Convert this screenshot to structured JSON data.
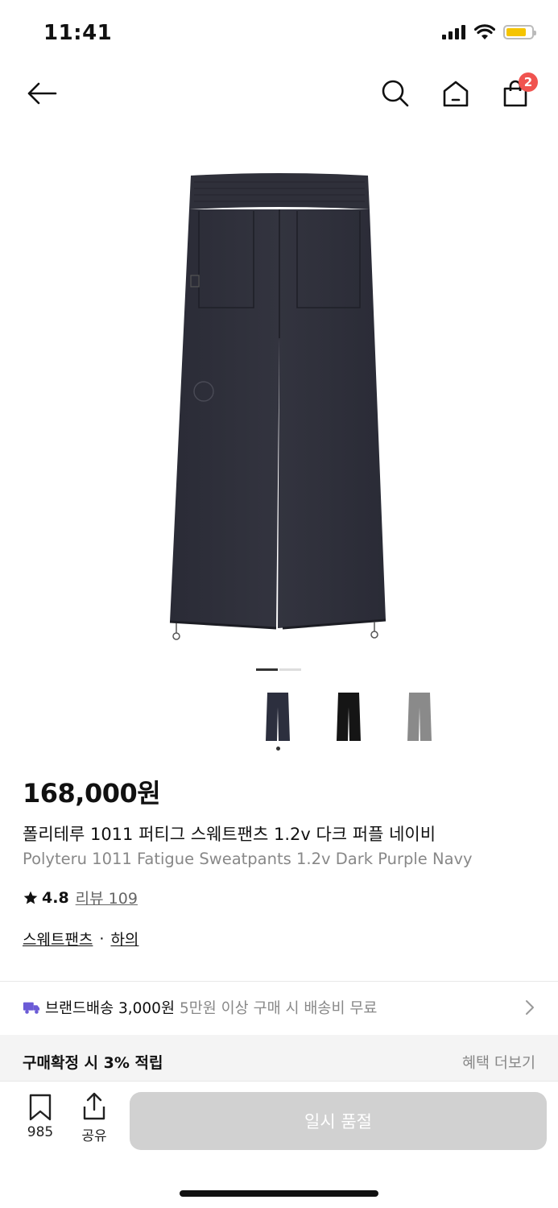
{
  "status_bar": {
    "time": "11:41"
  },
  "header": {
    "cart_count": "2"
  },
  "product": {
    "price": "168,000원",
    "name_ko": "폴리테루 1011 퍼티그 스웨트팬츠 1.2v 다크 퍼플 네이비",
    "name_en": "Polyteru 1011 Fatigue Sweatpants 1.2v Dark Purple Navy",
    "rating": "4.8",
    "review_label": "리뷰 109",
    "categories": [
      "스웨트팬츠",
      "하의"
    ],
    "category_separator": "·",
    "image_index": 1,
    "image_total": 2,
    "color_options": [
      {
        "name": "dark-purple-navy",
        "color": "#2c2f3e",
        "selected": true
      },
      {
        "name": "black",
        "color": "#151515",
        "selected": false
      },
      {
        "name": "gray",
        "color": "#8a8a8a",
        "selected": false
      }
    ]
  },
  "shipping": {
    "label": "브랜드배송 3,000원",
    "note": "5만원 이상 구매 시 배송비 무료",
    "icon_color": "#6b5bd6"
  },
  "benefit": {
    "label": "구매확정 시 3% 적립",
    "more_label": "혜택 더보기"
  },
  "bottom_bar": {
    "bookmark_count": "985",
    "share_label": "공유",
    "buy_label": "일시 품절"
  },
  "colors": {
    "badge": "#f0534f",
    "disabled_button": "#d1d1d1",
    "battery": "#f5c400"
  }
}
